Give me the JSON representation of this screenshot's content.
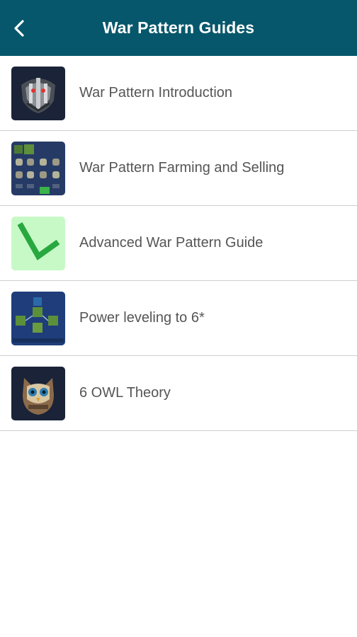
{
  "header": {
    "title": "War Pattern Guides",
    "back_icon": "chevron-left-icon",
    "background_color": "#06576b"
  },
  "guides": [
    {
      "label": "War Pattern Introduction",
      "thumbnail": "war-mask-icon"
    },
    {
      "label": "War Pattern Farming and Selling",
      "thumbnail": "farming-grid-icon"
    },
    {
      "label": "Advanced War Pattern Guide",
      "thumbnail": "green-check-icon"
    },
    {
      "label": "Power leveling to 6*",
      "thumbnail": "power-level-tree-icon"
    },
    {
      "label": "6 OWL Theory",
      "thumbnail": "owl-icon"
    }
  ],
  "colors": {
    "list_text": "#555555",
    "divider": "#cfcfcf",
    "check_bg": "#c7f9c7",
    "check_mark": "#29a83f"
  }
}
